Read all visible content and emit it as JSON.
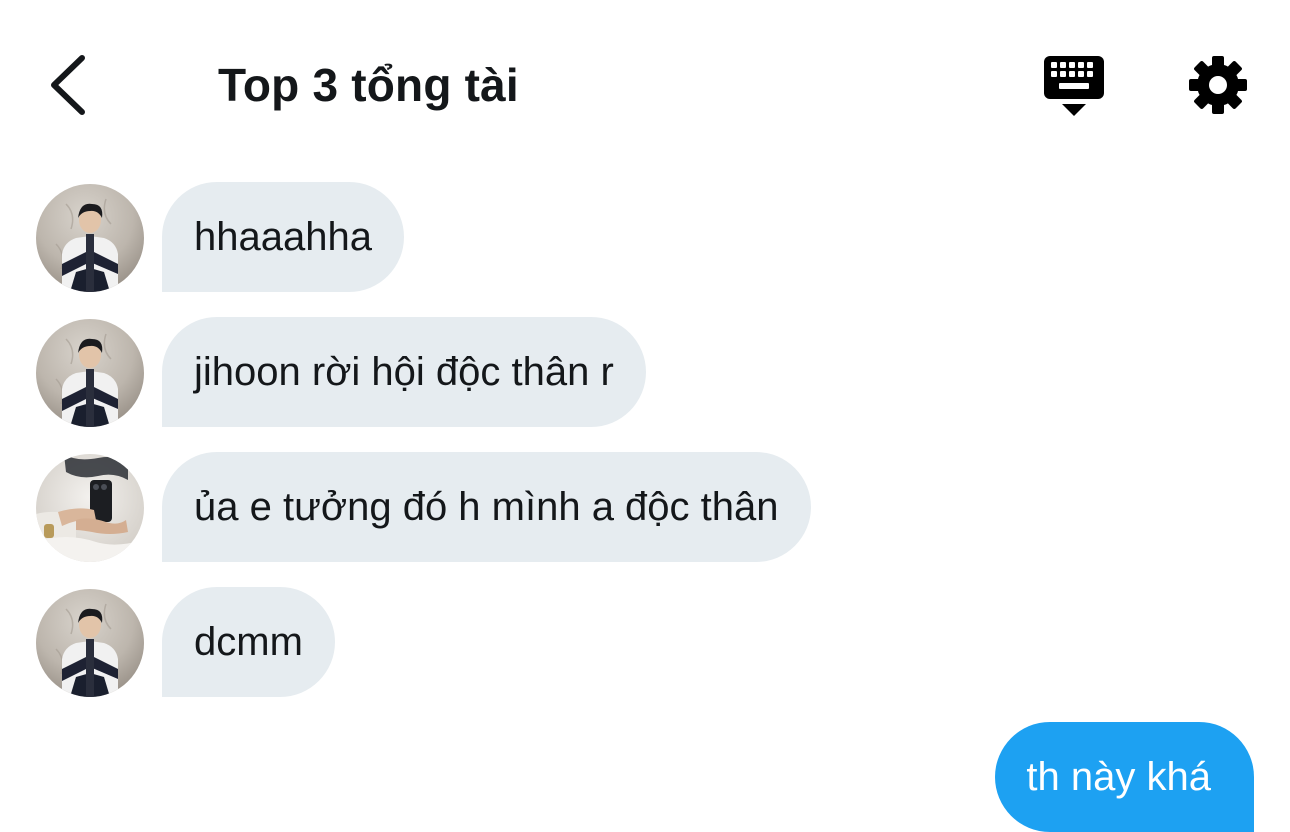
{
  "header": {
    "title": "Top 3 tổng tài",
    "back_icon": "chevron-left-icon",
    "keyboard_icon": "keyboard-icon",
    "settings_icon": "gear-icon"
  },
  "messages": [
    {
      "sender": "other",
      "avatar": "avatar-guy-jacket",
      "text": "hhaaahha"
    },
    {
      "sender": "other",
      "avatar": "avatar-guy-jacket",
      "text": "jihoon rời hội độc thân r"
    },
    {
      "sender": "other",
      "avatar": "avatar-mirror-selfie",
      "text": "ủa e tưởng đó h mình a độc thân"
    },
    {
      "sender": "other",
      "avatar": "avatar-guy-jacket",
      "text": "dcmm"
    },
    {
      "sender": "me",
      "text": "th này khá"
    }
  ],
  "colors": {
    "incoming_bubble": "#e6ecf0",
    "outgoing_bubble": "#1da1f2",
    "text": "#14171a"
  }
}
